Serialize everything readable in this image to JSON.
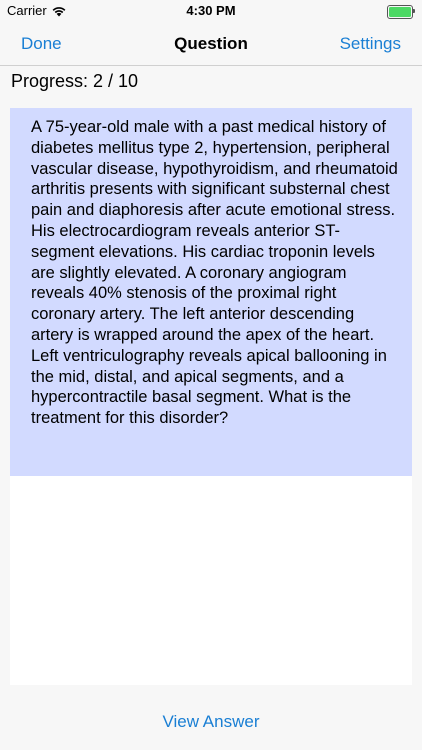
{
  "status_bar": {
    "carrier": "Carrier",
    "time": "4:30 PM",
    "battery_level": 1.0,
    "battery_color": "#4cd964"
  },
  "nav": {
    "left_button": "Done",
    "title": "Question",
    "right_button": "Settings",
    "tint_color": "#1a7fd4"
  },
  "progress": {
    "label": "Progress: 2 / 10",
    "current": 2,
    "total": 10
  },
  "question": {
    "text": "A 75-year-old male with a past medical history of diabetes mellitus type 2, hypertension, peripheral vascular disease, hypothyroidism, and rheumatoid arthritis presents with significant substernal chest pain and diaphoresis after acute emotional stress. His electrocardiogram reveals anterior ST-segment elevations. His cardiac troponin levels are slightly elevated. A coronary angiogram reveals 40% stenosis of the proximal right coronary artery. The left anterior descending artery is wrapped around the apex of the heart. Left ventriculography reveals apical ballooning in the mid, distal, and apical segments, and a hypercontractile basal segment. What is the treatment for this disorder?",
    "background_color": "#d2daff"
  },
  "footer": {
    "view_answer": "View Answer"
  },
  "icons": {
    "wifi": "wifi-icon",
    "battery": "battery-icon"
  }
}
